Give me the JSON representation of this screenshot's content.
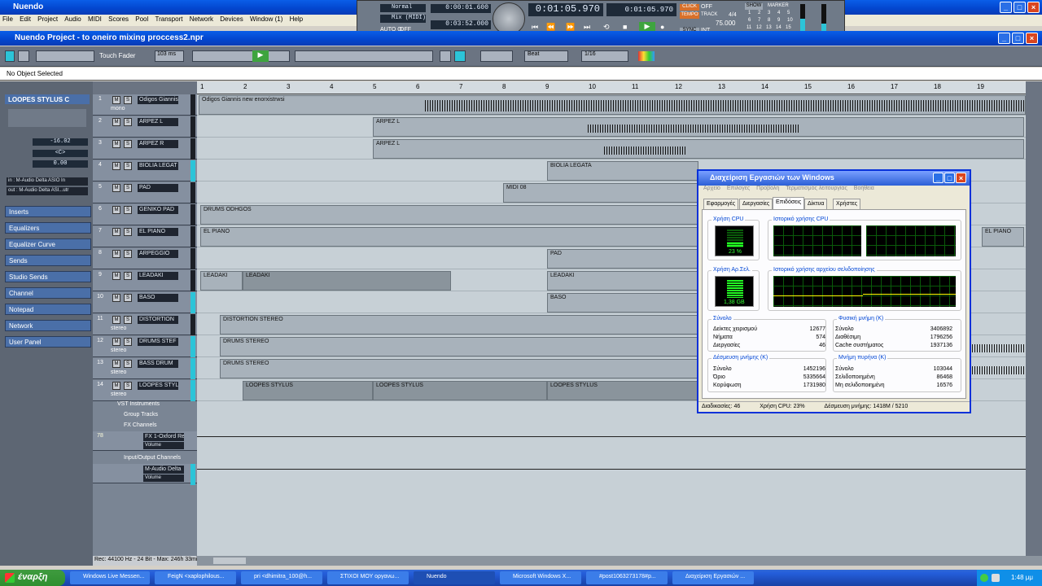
{
  "os_window": {
    "title": "Nuendo"
  },
  "menu": [
    "File",
    "Edit",
    "Project",
    "Audio",
    "MIDI",
    "Scores",
    "Pool",
    "Transport",
    "Network",
    "Devices",
    "Window (1)",
    "Help"
  ],
  "transport": {
    "mode": "Normal",
    "mix": "Mix (MIDI)",
    "auto_q": "AUTO Q",
    "off": "OFF",
    "left_locator": "0:00:01.600",
    "right_locator": "0:03:52.000",
    "position": "0:01:05.970",
    "position2": "0:01:05.970",
    "click": "CLICK",
    "click_state": "OFF",
    "tempo": "TEMPO",
    "track": "TRACK",
    "sig": "4/4",
    "tempo_val": "75.000",
    "sync": "SYNC",
    "sync_state": "INT.",
    "show": "SHOW",
    "marker": "MARKER",
    "marker_nums": [
      "1",
      "2",
      "3",
      "4",
      "5",
      "6",
      "7",
      "8",
      "9",
      "10",
      "11",
      "12",
      "13",
      "14",
      "15"
    ]
  },
  "project": {
    "title": "Nuendo Project - to oneiro mixing proccess2.npr"
  },
  "toolbar": {
    "fader_mode": "Touch Fader",
    "time": "103 ms",
    "snap": "Beat",
    "quantize": "1/16"
  },
  "info_line": "No Object Selected",
  "inspector": {
    "track_name": "LOOPES STYLUS C",
    "volume": "-16.02",
    "pan": "<C>",
    "delay": "0.00",
    "in": "in : M-Audio Delta ASIO In",
    "out": "out : M-Audio Delta ASI...utr",
    "sections": [
      "Inserts",
      "Equalizers",
      "Equalizer Curve",
      "Sends",
      "Studio Sends",
      "Channel",
      "Notepad",
      "Network",
      "User Panel"
    ]
  },
  "ruler": [
    "1",
    "2",
    "3",
    "4",
    "5",
    "6",
    "7",
    "8",
    "9",
    "10",
    "11",
    "12",
    "13",
    "14",
    "15",
    "16",
    "17",
    "18",
    "19"
  ],
  "tracks": [
    {
      "num": "1",
      "name": "Odigos Giannis",
      "sub": "mono"
    },
    {
      "num": "2",
      "name": "ARPEZ L",
      "sub": ""
    },
    {
      "num": "3",
      "name": "ARPEZ R",
      "sub": ""
    },
    {
      "num": "4",
      "name": "BIOLIA LEGAT",
      "sub": ""
    },
    {
      "num": "5",
      "name": "PAD",
      "sub": ""
    },
    {
      "num": "6",
      "name": "GENIKO PAD",
      "sub": ""
    },
    {
      "num": "7",
      "name": "EL PIANO",
      "sub": ""
    },
    {
      "num": "8",
      "name": "ARPEGGIO",
      "sub": ""
    },
    {
      "num": "9",
      "name": "LEADAKI",
      "sub": ""
    },
    {
      "num": "10",
      "name": "BASO",
      "sub": ""
    },
    {
      "num": "11",
      "name": "DISTORTION",
      "sub": "stereo"
    },
    {
      "num": "12",
      "name": "DRUMS STEF",
      "sub": "stereo"
    },
    {
      "num": "13",
      "name": "BASS DRUM",
      "sub": "stereo"
    },
    {
      "num": "14",
      "name": "LOOPES STYL",
      "sub": "stereo"
    }
  ],
  "folders": [
    "VST Instruments",
    "Group Tracks",
    "FX Channels",
    "Input/Output Channels"
  ],
  "fx_track": {
    "num": "78",
    "name": "FX 1-Oxford Re",
    "param": "Volume"
  },
  "io_track": {
    "name": "M-Audio Delta",
    "param": "Volume"
  },
  "parts": {
    "p1": "Odigos Giannis new enorxistrwsi",
    "p2": "ARPEZ L",
    "p3": "ARPEZ L",
    "p4": "BIOLIA LEGATA",
    "p5": "MIDI 08",
    "p6": "DRUMS ODHGOS",
    "p7a": "EL PIANO",
    "p7b": "EL PIANO",
    "p8": "PAD",
    "p9a": "LEADAKI",
    "p9b": "LEADAKI",
    "p9c": "LEADAKI",
    "p10": "BASO",
    "p11": "DISTORTION STEREO",
    "p12": "DRUMS STEREO",
    "p13": "DRUMS STEREO",
    "p14a": "LOOPES STYLUS",
    "p14b": "LOOPES STYLUS",
    "p14c": "LOOPES STYLUS"
  },
  "status_left": "Rec: 44100 Hz - 24 Bit - Max: 246h 33min",
  "taskmgr": {
    "title": "Διαχείριση Εργασιών των Windows",
    "menu": [
      "Αρχείο",
      "Επιλογές",
      "Προβολή",
      "Τερματισμός λειτουργίας",
      "Βοήθεια"
    ],
    "tabs": [
      "Εφαρμογές",
      "Διεργασίες",
      "Επιδόσεις",
      "Δίκτυα",
      "Χρήστες"
    ],
    "cpu_usage_label": "Χρήση CPU",
    "cpu_history_label": "Ιστορικό χρήσης CPU",
    "cpu_value": "23 %",
    "pf_label": "Χρήση Αρ.Σελ.",
    "pf_history_label": "Ιστορικό χρήσης αρχείου σελιδοποίησης",
    "pf_value": "1,38 GB",
    "totals_label": "Σύνολο",
    "totals": [
      [
        "Δείκτες χειρισμού",
        "12677"
      ],
      [
        "Νήματα",
        "574"
      ],
      [
        "Διεργασίες",
        "46"
      ]
    ],
    "phys_label": "Φυσική μνήμη (K)",
    "phys": [
      [
        "Σύνολο",
        "3406892"
      ],
      [
        "Διαθέσιμη",
        "1796256"
      ],
      [
        "Cache συστήματος",
        "1937136"
      ]
    ],
    "commit_label": "Δέσμευση μνήμης (K)",
    "commit": [
      [
        "Σύνολο",
        "1452196"
      ],
      [
        "Όριο",
        "5335664"
      ],
      [
        "Κορύφωση",
        "1731980"
      ]
    ],
    "kernel_label": "Μνήμη πυρήνα (K)",
    "kernel": [
      [
        "Σύνολο",
        "103044"
      ],
      [
        "Σελιδοποιημένη",
        "86468"
      ],
      [
        "Μη σελιδοποιημένη",
        "16576"
      ]
    ],
    "status": [
      "Διαδικασίες: 46",
      "Χρήση CPU: 23%",
      "Δέσμευση μνήμης: 1418M / 5210"
    ]
  },
  "taskbar": {
    "start": "έναρξη",
    "tasks": [
      "Windows Live Messen...",
      "FeigN <xaplophilous...",
      "pri <dhimitra_100@h...",
      "ΣΤΙΧΟΙ ΜΟΥ οργανω...",
      "Nuendo",
      "Microsoft Windows X...",
      "#post1063273178#p...",
      "Διαχείριση Εργασιών ..."
    ],
    "clock": "1:48 μμ"
  }
}
